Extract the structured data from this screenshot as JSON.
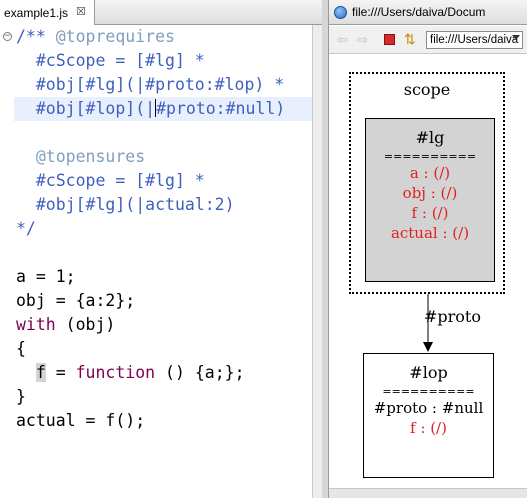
{
  "editor": {
    "tab_label": "example1.js",
    "close_glyph": "☒",
    "fold_glyph": "−",
    "lines": [
      {
        "a": "/** ",
        "b": "@toprequires"
      },
      {
        "a": "  #cScope = [#lg] *"
      },
      {
        "a": "  #obj[#lg](|#proto:#lop) *"
      },
      {
        "a": "  #obj[#lop](|",
        "b": "#proto:#null)"
      },
      {
        "a": ""
      },
      {
        "a": "  ",
        "b": "@topensures"
      },
      {
        "a": "  #cScope = [#lg] *"
      },
      {
        "a": "  #obj[#lg](|actual:2)"
      },
      {
        "a": "*/"
      },
      {
        "a": ""
      },
      {
        "a": "a = 1;"
      },
      {
        "a": "obj = {a:2};"
      },
      {
        "kw": "with",
        "a": " (obj)"
      },
      {
        "a": "{"
      },
      {
        "a": "  ",
        "v": "f",
        "b": " = ",
        "kw": "function",
        "c": " () {a;};"
      },
      {
        "a": "}"
      },
      {
        "a": "actual = f();"
      }
    ]
  },
  "browser": {
    "tab_title": "file:///Users/daiva/Docum",
    "url": "file:///Users/daiva",
    "back_glyph": "⇦",
    "forward_glyph": "⇨",
    "refresh_glyph": "⇅"
  },
  "diagram": {
    "scope_label": "scope",
    "edge_label": "#proto",
    "nodes": {
      "lg": {
        "title": "#lg",
        "separator": "==========",
        "props": [
          "a : (/)",
          "obj : (/)",
          "f : (/)",
          "actual : (/)"
        ]
      },
      "lop": {
        "title": "#lop",
        "separator": "==========",
        "proto_prop": "#proto : #null",
        "props": [
          "f : (/)"
        ]
      }
    }
  },
  "colors": {
    "keyword": "#7f0055",
    "javadoc": "#3f5fbf",
    "doc_tag": "#7f9fbf",
    "prop_red": "#e02020",
    "lg_fill": "#d3d3d3"
  }
}
